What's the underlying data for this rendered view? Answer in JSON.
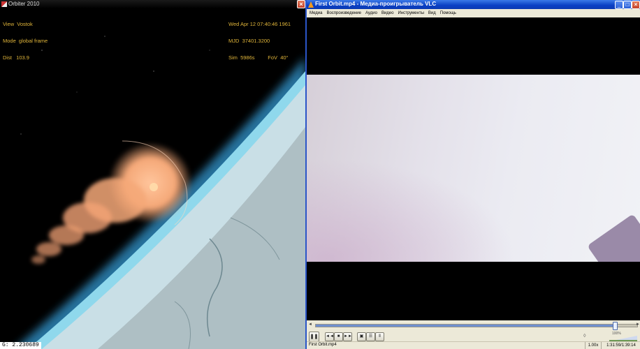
{
  "orbiter": {
    "title": "Orbiter 2010",
    "close_glyph": "×",
    "hud_left": [
      "View  Vostok",
      "Mode  global frame",
      "Dist   103.9"
    ],
    "hud_right": [
      "Wed Apr 12 07:40:46 1961",
      "MJD  37401.3200",
      "Sim  5986s         FoV  40°"
    ],
    "g_readout": "G: 2.230689",
    "colors": {
      "hud": "#e0b53a",
      "atmosphere": "#6ec8e8",
      "plume": "#f5a878"
    }
  },
  "vlc": {
    "title": "First Orbit.mp4 - Медиа-проигрыватель VLC",
    "window_buttons": {
      "minimize": "_",
      "maximize": "□",
      "close": "×"
    },
    "menu": [
      "Медиа",
      "Воспроизведение",
      "Аудио",
      "Видео",
      "Инструменты",
      "Вид",
      "Помощь"
    ],
    "seek": {
      "left": "◄",
      "right": "►",
      "position_fraction": 0.93
    },
    "controls": {
      "pause": "❚❚",
      "prev": "◄◄",
      "stop": "■",
      "next": "►►",
      "fullscreen": "▣",
      "playlist": "☰",
      "extended": "⦀"
    },
    "volume": {
      "icon": "speaker-icon",
      "glyph": "◊",
      "label": "100%",
      "level_fraction": 1.0
    },
    "status": {
      "file": "First Orbit.mp4",
      "speed": "1.00x",
      "time": "1:31:59/1:39:14"
    }
  }
}
